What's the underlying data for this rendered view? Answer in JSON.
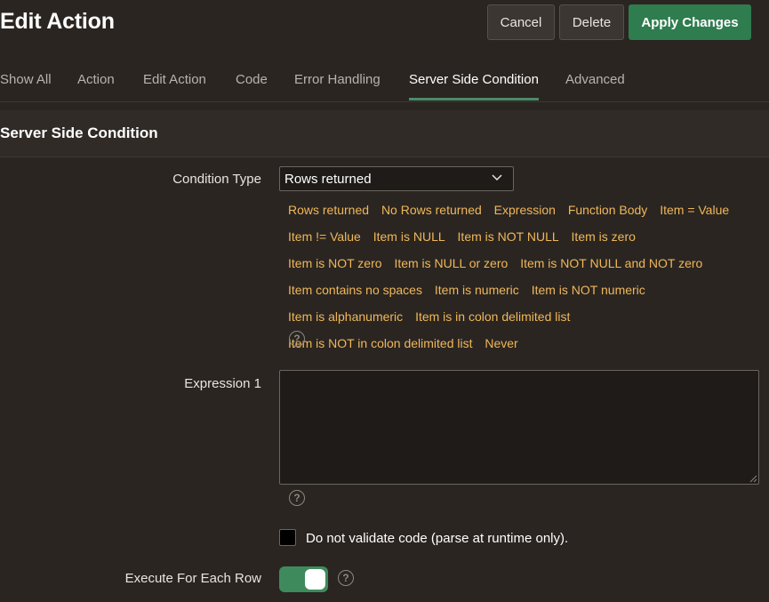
{
  "header": {
    "title": "Edit Action",
    "cancel_label": "Cancel",
    "delete_label": "Delete",
    "apply_label": "Apply Changes"
  },
  "tabs": [
    {
      "label": "Show All",
      "active": false
    },
    {
      "label": "Action",
      "active": false
    },
    {
      "label": "Edit Action",
      "active": false
    },
    {
      "label": "Code",
      "active": false
    },
    {
      "label": "Error Handling",
      "active": false
    },
    {
      "label": "Server Side Condition",
      "active": true
    },
    {
      "label": "Advanced",
      "active": false
    }
  ],
  "section": {
    "title": "Server Side Condition"
  },
  "condition_type": {
    "label": "Condition Type",
    "selected": "Rows returned",
    "quick_picks": [
      "Rows returned",
      "No Rows returned",
      "Expression",
      "Function Body",
      "Item = Value",
      "Item != Value",
      "Item is NULL",
      "Item is NOT NULL",
      "Item is zero",
      "Item is NOT zero",
      "Item is NULL or zero",
      "Item is NOT NULL and NOT zero",
      "Item contains no spaces",
      "Item is numeric",
      "Item is NOT numeric",
      "Item is alphanumeric",
      "Item is in colon delimited list",
      "Item is NOT in colon delimited list",
      "Never"
    ],
    "help": "?"
  },
  "expression1": {
    "label": "Expression 1",
    "value": "",
    "help": "?"
  },
  "validate": {
    "label": "Do not validate code (parse at runtime only).",
    "checked": false
  },
  "execute_each_row": {
    "label": "Execute For Each Row",
    "on": true,
    "help": "?"
  },
  "colors": {
    "accent_green": "#2f7c4f",
    "link_orange": "#f0b75a",
    "background": "#2a2521"
  }
}
